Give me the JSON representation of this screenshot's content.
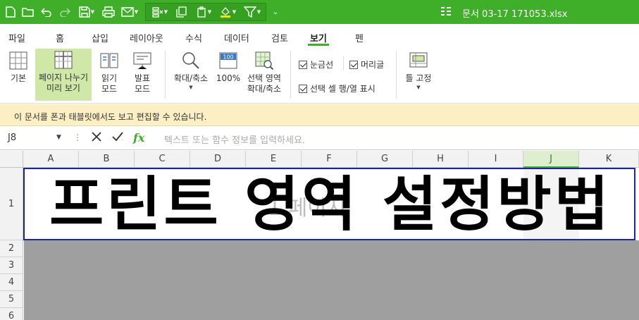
{
  "titlebar": {
    "document_title": "문서 03-17 171053.xlsx",
    "quick_access": [
      "new-document-icon",
      "open-folder-icon",
      "undo-icon",
      "redo-icon",
      "save-icon",
      "print-icon",
      "mail-icon",
      "cell-format-icon",
      "copy-format-icon",
      "paste-icon",
      "fill-color-icon",
      "filter-icon",
      "more-icon"
    ]
  },
  "tabs": [
    {
      "label": "파일"
    },
    {
      "label": "홈"
    },
    {
      "label": "삽입"
    },
    {
      "label": "레이아웃"
    },
    {
      "label": "수식"
    },
    {
      "label": "데이터"
    },
    {
      "label": "검토"
    },
    {
      "label": "보기",
      "active": true
    },
    {
      "label": "펜"
    }
  ],
  "ribbon": {
    "normal_label": "기본",
    "page_break_label_1": "페이지 나누기",
    "page_break_label_2": "미리 보기",
    "reading_label_1": "읽기",
    "reading_label_2": "모드",
    "presentation_label_1": "발표",
    "presentation_label_2": "모드",
    "zoom_label": "확대/축소",
    "zoom100_label": "100%",
    "zoom100_icon_text": "100",
    "zoom_selection_label_1": "선택 영역",
    "zoom_selection_label_2": "확대/축소",
    "gridlines_label": "눈금선",
    "headings_label": "머리글",
    "highlight_label": "선택 셀 행/열 표시",
    "freeze_label": "틀 고정"
  },
  "infobar": {
    "message": "이 문서를 폰과 태블릿에서도 보고 편집할 수 있습니다."
  },
  "formula_bar": {
    "cell_ref": "J8",
    "fx_label": "fx",
    "placeholder": "텍스트 또는 함수 정보를 입력하세요."
  },
  "grid": {
    "columns": [
      "A",
      "B",
      "C",
      "D",
      "E",
      "F",
      "G",
      "H",
      "I",
      "J",
      "K"
    ],
    "selected_column": "J",
    "rows": [
      "1",
      "2",
      "3",
      "4",
      "5",
      "6"
    ],
    "cell_A1": "프린트 영역 설정방법",
    "page_watermark": "1 페이지"
  },
  "colors": {
    "accent": "#3fae28",
    "print_area_border": "#1a25a8",
    "infobar_bg": "#fdefc4",
    "outside_print_area": "#9f9f9f"
  }
}
